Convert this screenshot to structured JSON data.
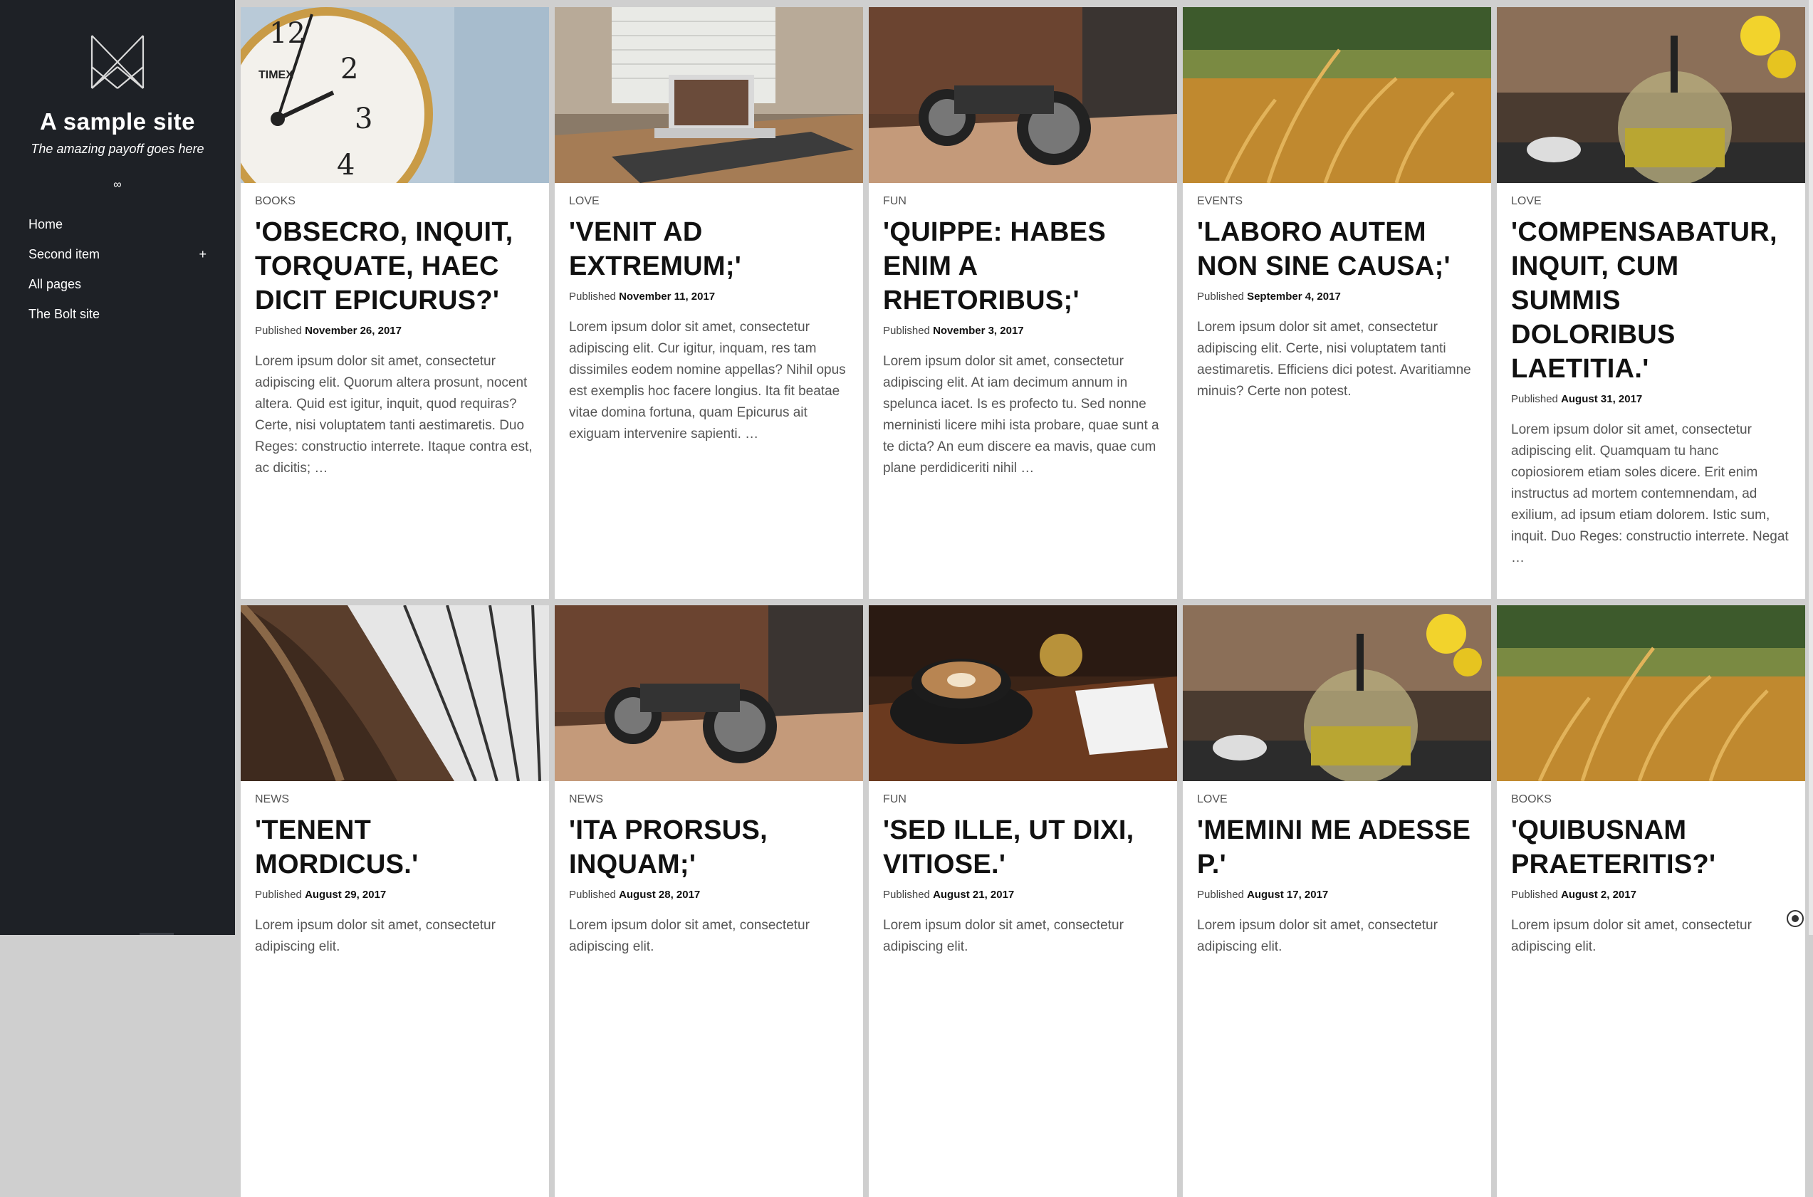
{
  "site": {
    "title": "A sample site",
    "payoff": "The amazing payoff goes here",
    "infinity": "∞",
    "logo_icon": "bolt-logo-icon"
  },
  "nav": [
    {
      "label": "Home"
    },
    {
      "label": "Second item",
      "toggle": "+"
    },
    {
      "label": "All pages"
    },
    {
      "label": "The Bolt site"
    }
  ],
  "published_label": "Published",
  "cards": [
    {
      "category": "Books",
      "title": "'Obsecro, inquit, Torquate, haec dicit Epicurus?'",
      "date": "November 26, 2017",
      "excerpt": "Lorem ipsum dolor sit amet, consectetur adipiscing elit. Quorum altera prosunt, nocent altera. Quid est igitur, inquit, quod requiras? Certe, nisi voluptatem tanti aestimaretis. Duo Reges: constructio interrete. Itaque contra est, ac dicitis; …",
      "image": "alarm-clock-photo"
    },
    {
      "category": "Love",
      "title": "'Venit ad extremum;'",
      "date": "November 11, 2017",
      "excerpt": "Lorem ipsum dolor sit amet, consectetur adipiscing elit. Cur igitur, inquam, res tam dissimiles eodem nomine appellas? Nihil opus est exemplis hoc facere longius. Ita fit beatae vitae domina fortuna, quam Epicurus ait exiguam intervenire sapienti. …",
      "image": "laptop-desk-photo"
    },
    {
      "category": "Fun",
      "title": "'Quippe: habes enim a rhetoribus;'",
      "date": "November 3, 2017",
      "excerpt": "Lorem ipsum dolor sit amet, consectetur adipiscing elit. At iam decimum annum in spelunca iacet. Is es profecto tu. Sed nonne merninisti licere mihi ista probare, quae sunt a te dicta? An eum discere ea mavis, quae cum plane perdidiceriti nihil …",
      "image": "motorcycle-garage-photo"
    },
    {
      "category": "Events",
      "title": "'Laboro autem non sine causa;'",
      "date": "September 4, 2017",
      "excerpt": "Lorem ipsum dolor sit amet, consectetur adipiscing elit. Certe, nisi voluptatem tanti aestimaretis. Efficiens dici potest. Avaritiamne minuis? Certe non potest.",
      "image": "wheat-field-photo"
    },
    {
      "category": "Love",
      "title": "'Compensabatur, inquit, cum summis doloribus laetitia.'",
      "date": "August 31, 2017",
      "excerpt": "Lorem ipsum dolor sit amet, consectetur adipiscing elit. Quamquam tu hanc copiosiorem etiam soles dicere. Erit enim instructus ad mortem contemnendam, ad exilium, ad ipsum etiam dolorem. Istic sum, inquit. Duo Reges: constructio interrete. Negat …",
      "image": "teapot-flowers-photo"
    },
    {
      "category": "News",
      "title": "'Tenent mordicus.'",
      "date": "August 29, 2017",
      "excerpt": "Lorem ipsum dolor sit amet, consectetur adipiscing elit.",
      "image": "library-shelves-photo"
    },
    {
      "category": "News",
      "title": "'Ita prorsus, inquam;'",
      "date": "August 28, 2017",
      "excerpt": "Lorem ipsum dolor sit amet, consectetur adipiscing elit.",
      "image": "motorcycle-garage-photo"
    },
    {
      "category": "Fun",
      "title": "'Sed ille, ut dixi, vitiose.'",
      "date": "August 21, 2017",
      "excerpt": "Lorem ipsum dolor sit amet, consectetur adipiscing elit.",
      "image": "coffee-cup-photo"
    },
    {
      "category": "Love",
      "title": "'Memini me adesse P.'",
      "date": "August 17, 2017",
      "excerpt": "Lorem ipsum dolor sit amet, consectetur adipiscing elit.",
      "image": "teapot-flowers-photo"
    },
    {
      "category": "Books",
      "title": "'Quibusnam praeteritis?'",
      "date": "August 2, 2017",
      "excerpt": "Lorem ipsum dolor sit amet, consectetur adipiscing elit.",
      "image": "wheat-field-photo"
    }
  ],
  "colors": {
    "sidebar_bg": "#1e2126",
    "page_bg": "#cfcfcf",
    "card_bg": "#ffffff"
  }
}
